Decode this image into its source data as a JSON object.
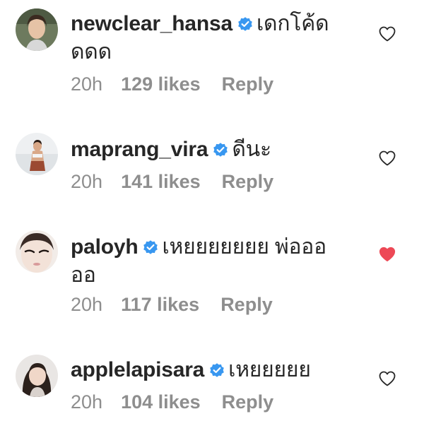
{
  "comments": [
    {
      "username": "newclear_hansa",
      "text_line1": "เดกโค้ด",
      "text_line2": "ดดด",
      "time": "20h",
      "likes": "129 likes",
      "reply": "Reply",
      "liked": false
    },
    {
      "username": "maprang_vira",
      "text_line1": "ดีนะ",
      "text_line2": "",
      "time": "20h",
      "likes": "141 likes",
      "reply": "Reply",
      "liked": false
    },
    {
      "username": "paloyh",
      "text_line1": "เหยยยยยยย พ่อออ",
      "text_line2": "ออ",
      "time": "20h",
      "likes": "117 likes",
      "reply": "Reply",
      "liked": true
    },
    {
      "username": "applelapisara",
      "text_line1": "เหยยยยย",
      "text_line2": "",
      "time": "20h",
      "likes": "104 likes",
      "reply": "Reply",
      "liked": false
    }
  ],
  "colors": {
    "verified": "#3897f0",
    "liked_heart": "#ed4956",
    "meta_text": "#8e8e8e",
    "username_text": "#262626"
  },
  "icons": {
    "verified": "verified-badge-icon",
    "like": "heart-icon"
  }
}
